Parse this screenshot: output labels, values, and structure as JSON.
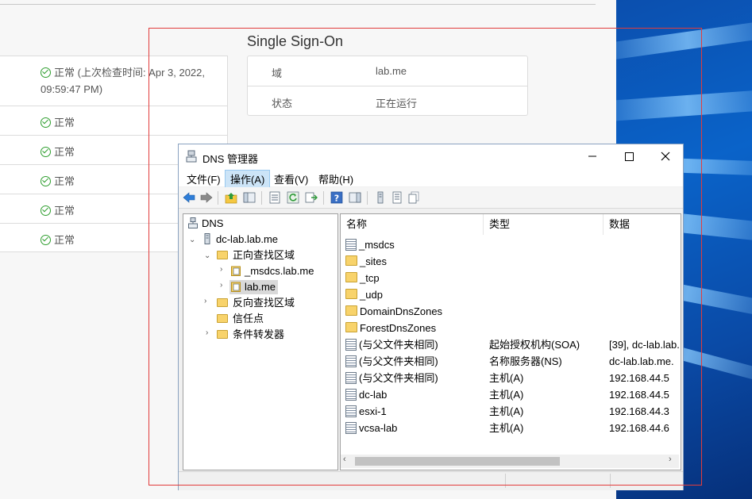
{
  "vsphere": {
    "status_rows": [
      {
        "line1": "正常 (上次检查时间: Apr 3, 2022,",
        "line2": "09:59:47 PM)"
      },
      {
        "line1": "正常"
      },
      {
        "line1": "正常"
      },
      {
        "line1": "正常"
      },
      {
        "line1": "正常"
      },
      {
        "line1": "正常"
      }
    ],
    "sso": {
      "title": "Single Sign-On",
      "rows": [
        {
          "key": "域",
          "value": "lab.me"
        },
        {
          "key": "状态",
          "value": "正在运行"
        }
      ]
    }
  },
  "dns_window": {
    "title": "DNS 管理器",
    "menus": [
      "文件(F)",
      "操作(A)",
      "查看(V)",
      "帮助(H)"
    ],
    "active_menu_index": 1,
    "tree": {
      "root": "DNS",
      "server": "dc-lab.lab.me",
      "forward_zones": "正向查找区域",
      "zone_msdcs": "_msdcs.lab.me",
      "zone_lab": "lab.me",
      "reverse_zones": "反向查找区域",
      "trust_points": "信任点",
      "conditional_forwarders": "条件转发器"
    },
    "columns": [
      "名称",
      "类型",
      "数据"
    ],
    "records": [
      {
        "icon": "zone-icon",
        "name": "_msdcs",
        "type": "",
        "data": ""
      },
      {
        "icon": "folder-icon",
        "name": "_sites",
        "type": "",
        "data": ""
      },
      {
        "icon": "folder-icon",
        "name": "_tcp",
        "type": "",
        "data": ""
      },
      {
        "icon": "folder-icon",
        "name": "_udp",
        "type": "",
        "data": ""
      },
      {
        "icon": "folder-icon",
        "name": "DomainDnsZones",
        "type": "",
        "data": ""
      },
      {
        "icon": "folder-icon",
        "name": "ForestDnsZones",
        "type": "",
        "data": ""
      },
      {
        "icon": "record-icon",
        "name": "(与父文件夹相同)",
        "type": "起始授权机构(SOA)",
        "data": "[39], dc-lab.lab."
      },
      {
        "icon": "record-icon",
        "name": "(与父文件夹相同)",
        "type": "名称服务器(NS)",
        "data": "dc-lab.lab.me."
      },
      {
        "icon": "record-icon",
        "name": "(与父文件夹相同)",
        "type": "主机(A)",
        "data": "192.168.44.5"
      },
      {
        "icon": "record-icon",
        "name": "dc-lab",
        "type": "主机(A)",
        "data": "192.168.44.5"
      },
      {
        "icon": "record-icon",
        "name": "esxi-1",
        "type": "主机(A)",
        "data": "192.168.44.3"
      },
      {
        "icon": "record-icon",
        "name": "vcsa-lab",
        "type": "主机(A)",
        "data": "192.168.44.6"
      }
    ]
  },
  "colors": {
    "ok_green": "#2e9e2e",
    "highlight_red": "#e23c3c",
    "desktop_blue": "#0a63c9",
    "selection_blue": "#cce4f7"
  }
}
